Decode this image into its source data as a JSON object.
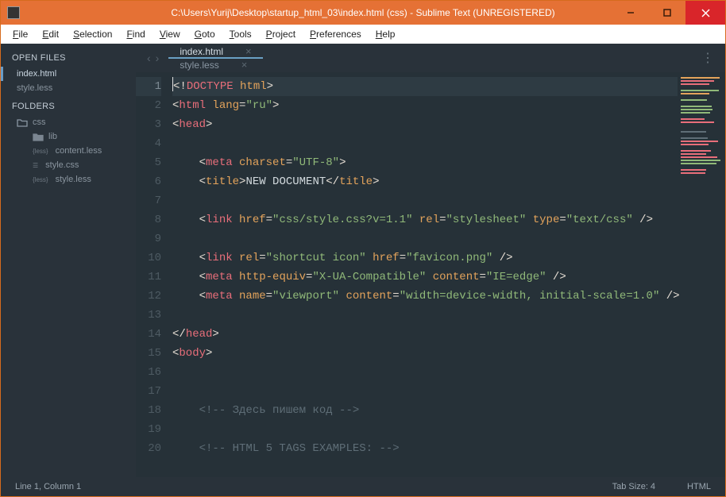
{
  "window": {
    "title": "C:\\Users\\Yurij\\Desktop\\startup_html_03\\index.html (css) - Sublime Text (UNREGISTERED)"
  },
  "menu": [
    {
      "label": "File",
      "u": 0
    },
    {
      "label": "Edit",
      "u": 0
    },
    {
      "label": "Selection",
      "u": 0
    },
    {
      "label": "Find",
      "u": 0
    },
    {
      "label": "View",
      "u": 0
    },
    {
      "label": "Goto",
      "u": 0
    },
    {
      "label": "Tools",
      "u": 0
    },
    {
      "label": "Project",
      "u": 0
    },
    {
      "label": "Preferences",
      "u": 0
    },
    {
      "label": "Help",
      "u": 0
    }
  ],
  "sidebar": {
    "open_files_label": "OPEN FILES",
    "open_files": [
      {
        "name": "index.html",
        "active": true
      },
      {
        "name": "style.less",
        "active": false
      }
    ],
    "folders_label": "FOLDERS",
    "root": "css",
    "lib": "lib",
    "files": [
      {
        "tag": "{less}",
        "name": "content.less"
      },
      {
        "tag": "☰",
        "name": "style.css"
      },
      {
        "tag": "{less}",
        "name": "style.less"
      }
    ]
  },
  "tabs": [
    {
      "label": "index.html",
      "active": true
    },
    {
      "label": "style.less",
      "active": false
    }
  ],
  "code": {
    "lines": [
      {
        "n": 1,
        "current": true,
        "tokens": [
          {
            "t": "punct",
            "v": "<!"
          },
          {
            "t": "tag",
            "v": "DOCTYPE "
          },
          {
            "t": "attr",
            "v": "html"
          },
          {
            "t": "punct",
            "v": ">"
          }
        ],
        "cursor_before": true
      },
      {
        "n": 2,
        "tokens": [
          {
            "t": "punct",
            "v": "<"
          },
          {
            "t": "tag",
            "v": "html "
          },
          {
            "t": "attr",
            "v": "lang"
          },
          {
            "t": "punct",
            "v": "="
          },
          {
            "t": "str",
            "v": "\"ru\""
          },
          {
            "t": "punct",
            "v": ">"
          }
        ]
      },
      {
        "n": 3,
        "tokens": [
          {
            "t": "punct",
            "v": "<"
          },
          {
            "t": "tag",
            "v": "head"
          },
          {
            "t": "punct",
            "v": ">"
          }
        ]
      },
      {
        "n": 4,
        "tokens": []
      },
      {
        "n": 5,
        "indent": 1,
        "tokens": [
          {
            "t": "punct",
            "v": "<"
          },
          {
            "t": "tag",
            "v": "meta "
          },
          {
            "t": "attr",
            "v": "charset"
          },
          {
            "t": "punct",
            "v": "="
          },
          {
            "t": "str",
            "v": "\"UTF-8\""
          },
          {
            "t": "punct",
            "v": ">"
          }
        ]
      },
      {
        "n": 6,
        "indent": 1,
        "tokens": [
          {
            "t": "punct",
            "v": "<"
          },
          {
            "t": "title",
            "v": "title"
          },
          {
            "t": "punct",
            "v": ">"
          },
          {
            "t": "text",
            "v": "NEW DOCUMENT"
          },
          {
            "t": "punct",
            "v": "</"
          },
          {
            "t": "title",
            "v": "title"
          },
          {
            "t": "punct",
            "v": ">"
          }
        ]
      },
      {
        "n": 7,
        "tokens": []
      },
      {
        "n": 8,
        "indent": 1,
        "tokens": [
          {
            "t": "punct",
            "v": "<"
          },
          {
            "t": "tag",
            "v": "link "
          },
          {
            "t": "attr",
            "v": "href"
          },
          {
            "t": "punct",
            "v": "="
          },
          {
            "t": "str",
            "v": "\"css/style.css?v=1.1\" "
          },
          {
            "t": "attr",
            "v": "rel"
          },
          {
            "t": "punct",
            "v": "="
          },
          {
            "t": "str",
            "v": "\"stylesheet\" "
          },
          {
            "t": "attr",
            "v": "type"
          },
          {
            "t": "punct",
            "v": "="
          },
          {
            "t": "str",
            "v": "\"text/css\""
          },
          {
            "t": "punct",
            "v": " />"
          }
        ]
      },
      {
        "n": 9,
        "tokens": []
      },
      {
        "n": 10,
        "indent": 1,
        "tokens": [
          {
            "t": "punct",
            "v": "<"
          },
          {
            "t": "tag",
            "v": "link "
          },
          {
            "t": "attr",
            "v": "rel"
          },
          {
            "t": "punct",
            "v": "="
          },
          {
            "t": "str",
            "v": "\"shortcut icon\" "
          },
          {
            "t": "attr",
            "v": "href"
          },
          {
            "t": "punct",
            "v": "="
          },
          {
            "t": "str",
            "v": "\"favicon.png\""
          },
          {
            "t": "punct",
            "v": " />"
          }
        ]
      },
      {
        "n": 11,
        "indent": 1,
        "tokens": [
          {
            "t": "punct",
            "v": "<"
          },
          {
            "t": "tag",
            "v": "meta "
          },
          {
            "t": "attr",
            "v": "http-equiv"
          },
          {
            "t": "punct",
            "v": "="
          },
          {
            "t": "str",
            "v": "\"X-UA-Compatible\" "
          },
          {
            "t": "attr",
            "v": "content"
          },
          {
            "t": "punct",
            "v": "="
          },
          {
            "t": "str",
            "v": "\"IE=edge\""
          },
          {
            "t": "punct",
            "v": " />"
          }
        ]
      },
      {
        "n": 12,
        "indent": 1,
        "tokens": [
          {
            "t": "punct",
            "v": "<"
          },
          {
            "t": "tag",
            "v": "meta "
          },
          {
            "t": "attr",
            "v": "name"
          },
          {
            "t": "punct",
            "v": "="
          },
          {
            "t": "str",
            "v": "\"viewport\" "
          },
          {
            "t": "attr",
            "v": "content"
          },
          {
            "t": "punct",
            "v": "="
          },
          {
            "t": "str",
            "v": "\"width=device-width, initial-scale=1.0\""
          },
          {
            "t": "punct",
            "v": " />"
          }
        ]
      },
      {
        "n": 13,
        "tokens": []
      },
      {
        "n": 14,
        "tokens": [
          {
            "t": "punct",
            "v": "</"
          },
          {
            "t": "tag",
            "v": "head"
          },
          {
            "t": "punct",
            "v": ">"
          }
        ]
      },
      {
        "n": 15,
        "tokens": [
          {
            "t": "punct",
            "v": "<"
          },
          {
            "t": "tag",
            "v": "body"
          },
          {
            "t": "punct",
            "v": ">"
          }
        ]
      },
      {
        "n": 16,
        "tokens": []
      },
      {
        "n": 17,
        "tokens": []
      },
      {
        "n": 18,
        "indent": 1,
        "tokens": [
          {
            "t": "comment",
            "v": "<!-- Здесь пишем код -->"
          }
        ]
      },
      {
        "n": 19,
        "tokens": []
      },
      {
        "n": 20,
        "indent": 1,
        "tokens": [
          {
            "t": "comment",
            "v": "<!-- HTML 5 TAGS EXAMPLES: -->"
          }
        ]
      }
    ]
  },
  "status": {
    "pos": "Line 1, Column 1",
    "tab_size": "Tab Size: 4",
    "syntax": "HTML"
  },
  "minimap_colors": [
    "#e3a35b",
    "#e86e7a",
    "#e86e7a",
    "",
    "#90b979",
    "#e3a35b",
    "",
    "#90b979",
    "",
    "#90b979",
    "#90b979",
    "#90b979",
    "",
    "#e86e7a",
    "#e86e7a",
    "",
    "",
    "#5f6e77",
    "",
    "#5f6e77",
    "#e86e7a",
    "#e86e7a",
    "",
    "#e86e7a",
    "#e86e7a",
    "#e86e7a",
    "#90b979",
    "#90b979",
    "",
    "#e86e7a",
    "#e86e7a"
  ]
}
